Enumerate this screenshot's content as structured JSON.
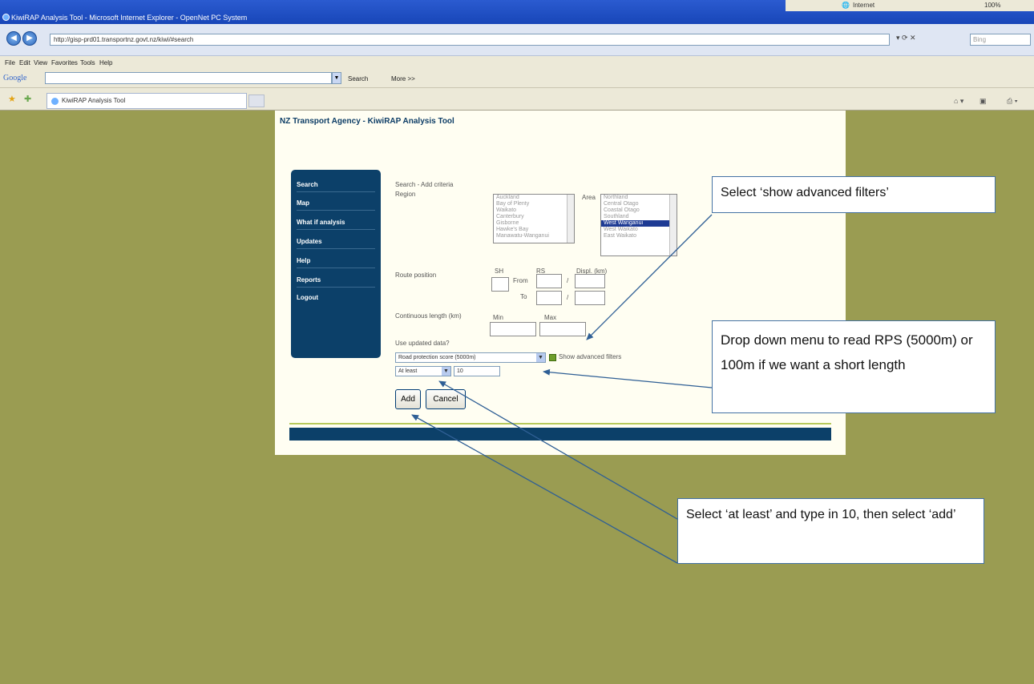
{
  "browser": {
    "window_title": "KiwiRAP Analysis Tool - Microsoft Internet Explorer - OpenNet PC System",
    "address": "http://gisp-prd01.transportnz.govt.nz/kiwi/#search",
    "search_placeholder": "Bing",
    "status_zone": "Internet",
    "zoom": "100%",
    "menu": [
      "File",
      "Edit",
      "View",
      "Favorites",
      "Tools",
      "Help"
    ],
    "google_label": "Google",
    "google_search": "Search",
    "google_more": "More >>",
    "tab_title": "KiwiRAP Analysis Tool"
  },
  "app": {
    "title": "NZ Transport Agency - KiwiRAP Analysis Tool",
    "nav": [
      "Search",
      "Map",
      "What if analysis",
      "Updates",
      "Help",
      "Reports",
      "Logout"
    ]
  },
  "form": {
    "heading": "Search - Add criteria",
    "region_label": "Region",
    "region_options": [
      "Auckland",
      "Bay of Plenty",
      "Waikato",
      "Canterbury",
      "Gisborne",
      "Hawke's Bay",
      "Manawatu-Wanganui"
    ],
    "area_label": "Area",
    "area_options": [
      "Northland",
      "Central Otago",
      "Coastal Otago",
      "Southland",
      "West Wanganui",
      "West Waikato",
      "East Waikato"
    ],
    "area_selected": 4,
    "route_label": "Route position",
    "sh_label": "SH",
    "rs_label": "RS",
    "displ_label": "Displ. (km)",
    "from_label": "From",
    "to_label": "To",
    "slash": "/",
    "length_label": "Continuous length (km)",
    "min_label": "Min",
    "max_label": "Max",
    "updated_label": "Use updated data?",
    "section_select": "Road protection score (5000m)",
    "advanced_label": "Show advanced filters",
    "operator_select": "At least",
    "value": "10",
    "add_label": "Add",
    "cancel_label": "Cancel"
  },
  "callouts": {
    "advanced": "Select ‘show advanced filters’",
    "dropdown": "Drop down menu to read RPS (5000m) or 100m if we want a short length",
    "atleast": "Select ‘at least’ and type in 10, then select ‘add’"
  },
  "colors": {
    "background": "#9a9c52",
    "nav": "#0c4069",
    "accent": "#b7c95b",
    "callout_border": "#4472a4"
  }
}
